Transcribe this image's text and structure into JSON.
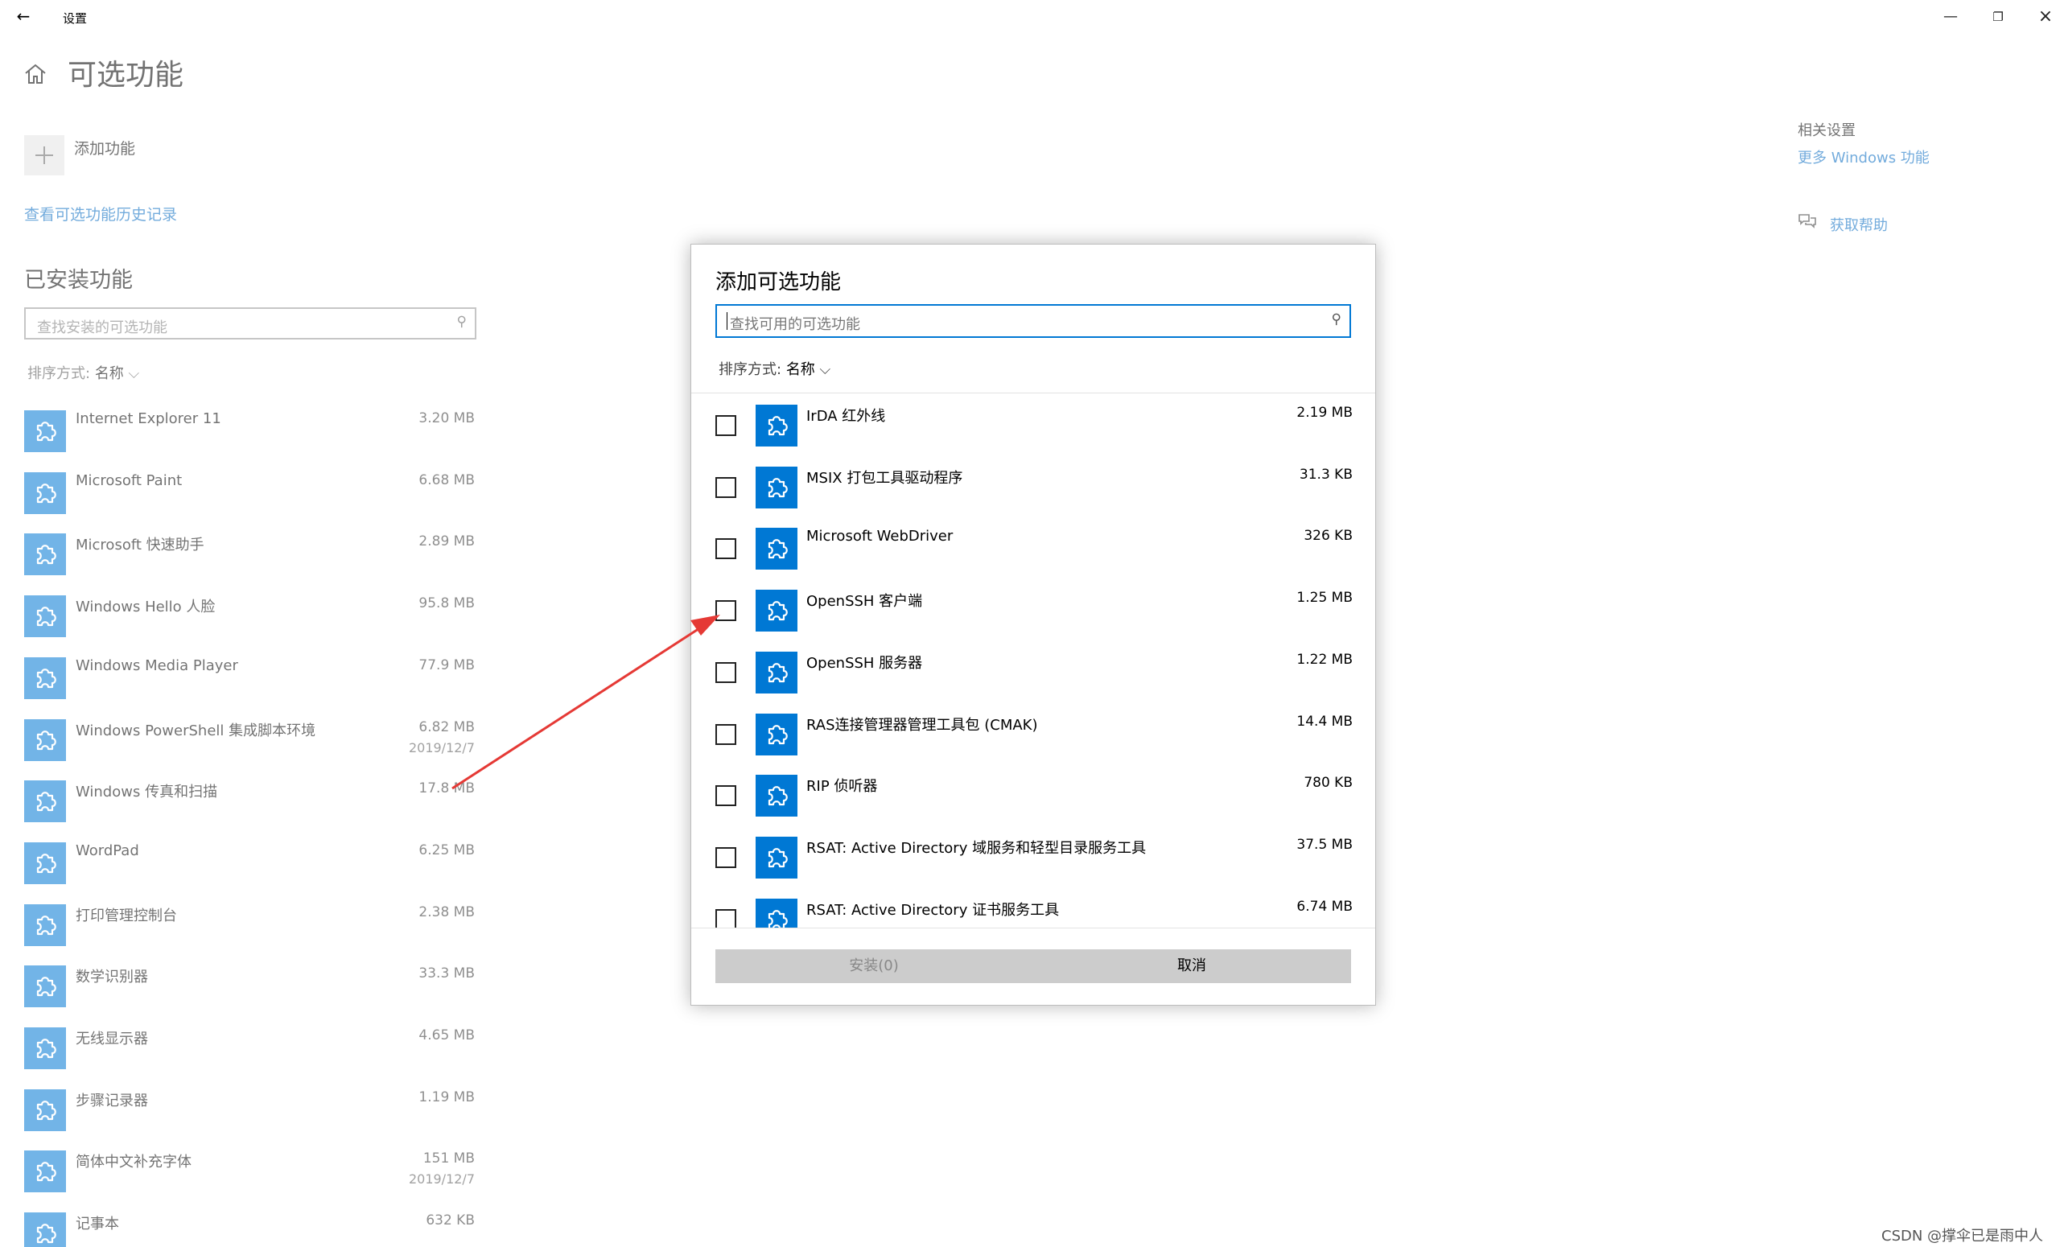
{
  "window": {
    "back_icon": "back-arrow-icon",
    "title": "设置",
    "minimize_icon": "minimize-icon",
    "maximize_icon": "restore-icon",
    "close_icon": "close-icon"
  },
  "page": {
    "title": "可选功能",
    "add_feature_label": "添加功能",
    "history_link": "查看可选功能历史记录",
    "installed_heading": "已安装功能",
    "installed_search_placeholder": "查找安装的可选功能",
    "sort_label": "排序方式:",
    "sort_value": "名称"
  },
  "installed_features": [
    {
      "name": "Internet Explorer 11",
      "size": "3.20 MB"
    },
    {
      "name": "Microsoft Paint",
      "size": "6.68 MB"
    },
    {
      "name": "Microsoft 快速助手",
      "size": "2.89 MB"
    },
    {
      "name": "Windows Hello 人脸",
      "size": "95.8 MB"
    },
    {
      "name": "Windows Media Player",
      "size": "77.9 MB"
    },
    {
      "name": "Windows PowerShell 集成脚本环境",
      "size": "6.82 MB",
      "date": "2019/12/7"
    },
    {
      "name": "Windows 传真和扫描",
      "size": "17.8 MB"
    },
    {
      "name": "WordPad",
      "size": "6.25 MB"
    },
    {
      "name": "打印管理控制台",
      "size": "2.38 MB"
    },
    {
      "name": "数学识别器",
      "size": "33.3 MB"
    },
    {
      "name": "无线显示器",
      "size": "4.65 MB"
    },
    {
      "name": "步骤记录器",
      "size": "1.19 MB"
    },
    {
      "name": "简体中文补充字体",
      "size": "151 MB",
      "date": "2019/12/7"
    },
    {
      "name": "记事本",
      "size": "632 KB"
    }
  ],
  "related": {
    "heading": "相关设置",
    "more_windows_features": "更多 Windows 功能",
    "get_help": "获取帮助"
  },
  "dialog": {
    "title": "添加可选功能",
    "search_placeholder": "查找可用的可选功能",
    "sort_label": "排序方式:",
    "sort_value": "名称",
    "options": [
      {
        "name": "IrDA 红外线",
        "size": "2.19 MB",
        "checked": false
      },
      {
        "name": "MSIX 打包工具驱动程序",
        "size": "31.3 KB",
        "checked": false
      },
      {
        "name": "Microsoft WebDriver",
        "size": "326 KB",
        "checked": false
      },
      {
        "name": "OpenSSH 客户端",
        "size": "1.25 MB",
        "checked": false
      },
      {
        "name": "OpenSSH 服务器",
        "size": "1.22 MB",
        "checked": false
      },
      {
        "name": "RAS连接管理器管理工具包 (CMAK)",
        "size": "14.4 MB",
        "checked": false
      },
      {
        "name": "RIP 侦听器",
        "size": "780 KB",
        "checked": false
      },
      {
        "name": "RSAT: Active Directory 域服务和轻型目录服务工具",
        "size": "37.5 MB",
        "checked": false
      },
      {
        "name": "RSAT: Active Directory 证书服务工具",
        "size": "6.74 MB",
        "checked": false
      }
    ],
    "install_button": "安装(0)",
    "cancel_button": "取消"
  },
  "colors": {
    "accent": "#0078d4",
    "link": "#0067c0",
    "annotation_arrow": "#e53935"
  },
  "watermark": "CSDN @撑伞已是雨中人"
}
